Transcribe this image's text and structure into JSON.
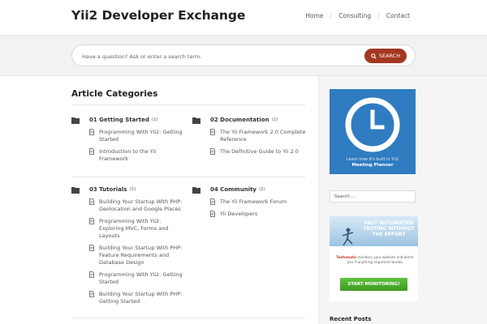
{
  "site": {
    "title": "Yii2 Developer Exchange"
  },
  "nav": {
    "items": [
      {
        "label": "Home"
      },
      {
        "label": "Consulting"
      },
      {
        "label": "Contact"
      }
    ],
    "separator": "/"
  },
  "search": {
    "placeholder": "Have a question? Ask or enter a search term.",
    "button_label": "SEARCH"
  },
  "main": {
    "title": "Article Categories",
    "categories": [
      {
        "name": "01 Getting Started",
        "count": "(2)",
        "articles": [
          "Programming With Yii2: Getting Started",
          "Introduction to the Yii Framework"
        ]
      },
      {
        "name": "02 Documentation",
        "count": "(2)",
        "articles": [
          "The Yii Framework 2.0 Complete Reference",
          "The Definitive Guide to Yii 2.0"
        ]
      },
      {
        "name": "03 Tutorials",
        "count": "(5)",
        "articles": [
          "Building Your Startup With PHP: Geolocation and Google Places",
          "Programming With Yii2: Exploring MVC, Forms and Layouts",
          "Building Your Startup With PHP: Feature Requirements and Database Design",
          "Programming With Yii2: Getting Started",
          "Building Your Startup With PHP: Getting Started"
        ]
      },
      {
        "name": "04 Community",
        "count": "(2)",
        "articles": [
          "The Yii Framework Forum",
          "Yii Developers"
        ]
      }
    ]
  },
  "sidebar": {
    "meeting_ad": {
      "line1": "Learn how it's built in Yii2",
      "line2": "Meeting Planner"
    },
    "search_placeholder": "Search ...",
    "testing_ad": {
      "headline": "FAST AUTOMATED TESTING WITHOUT THE EFFORT",
      "brand": "Testomato",
      "body": "monitors your website and alerts you if anything important breaks",
      "button": "START MONITORING!"
    },
    "recent_title": "Recent Posts"
  },
  "colors": {
    "accent": "#a33720",
    "ad_blue": "#2f7cc1",
    "cta_green": "#4caf2f"
  },
  "icons": {
    "folder": "folder-icon",
    "document": "document-icon",
    "search": "search-icon",
    "clock": "clock-icon"
  }
}
